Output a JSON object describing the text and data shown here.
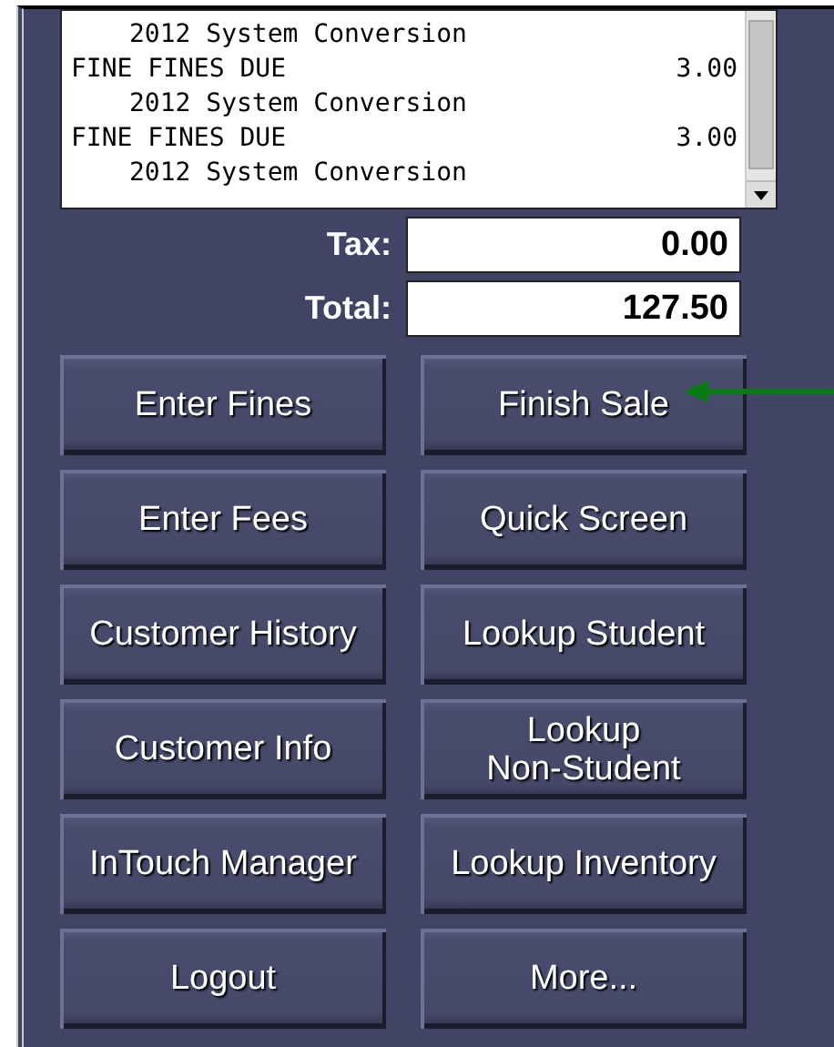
{
  "receipt_list": {
    "items": [
      {
        "note": "2012 System Conversion"
      },
      {
        "name": "FINE FINES DUE",
        "amount": "3.00",
        "note": "2012 System Conversion"
      },
      {
        "name": "FINE FINES DUE",
        "amount": "3.00",
        "note": "2012 System Conversion"
      }
    ]
  },
  "totals": [
    {
      "label": "Tax:",
      "value": "0.00"
    },
    {
      "label": "Total:",
      "value": "127.50"
    }
  ],
  "buttons": [
    "Enter Fines",
    "Finish Sale",
    "Enter Fees",
    "Quick Screen",
    "Customer History",
    "Lookup Student",
    "Customer Info",
    "Lookup\nNon-Student",
    "InTouch Manager",
    "Lookup Inventory",
    "Logout",
    "More..."
  ]
}
